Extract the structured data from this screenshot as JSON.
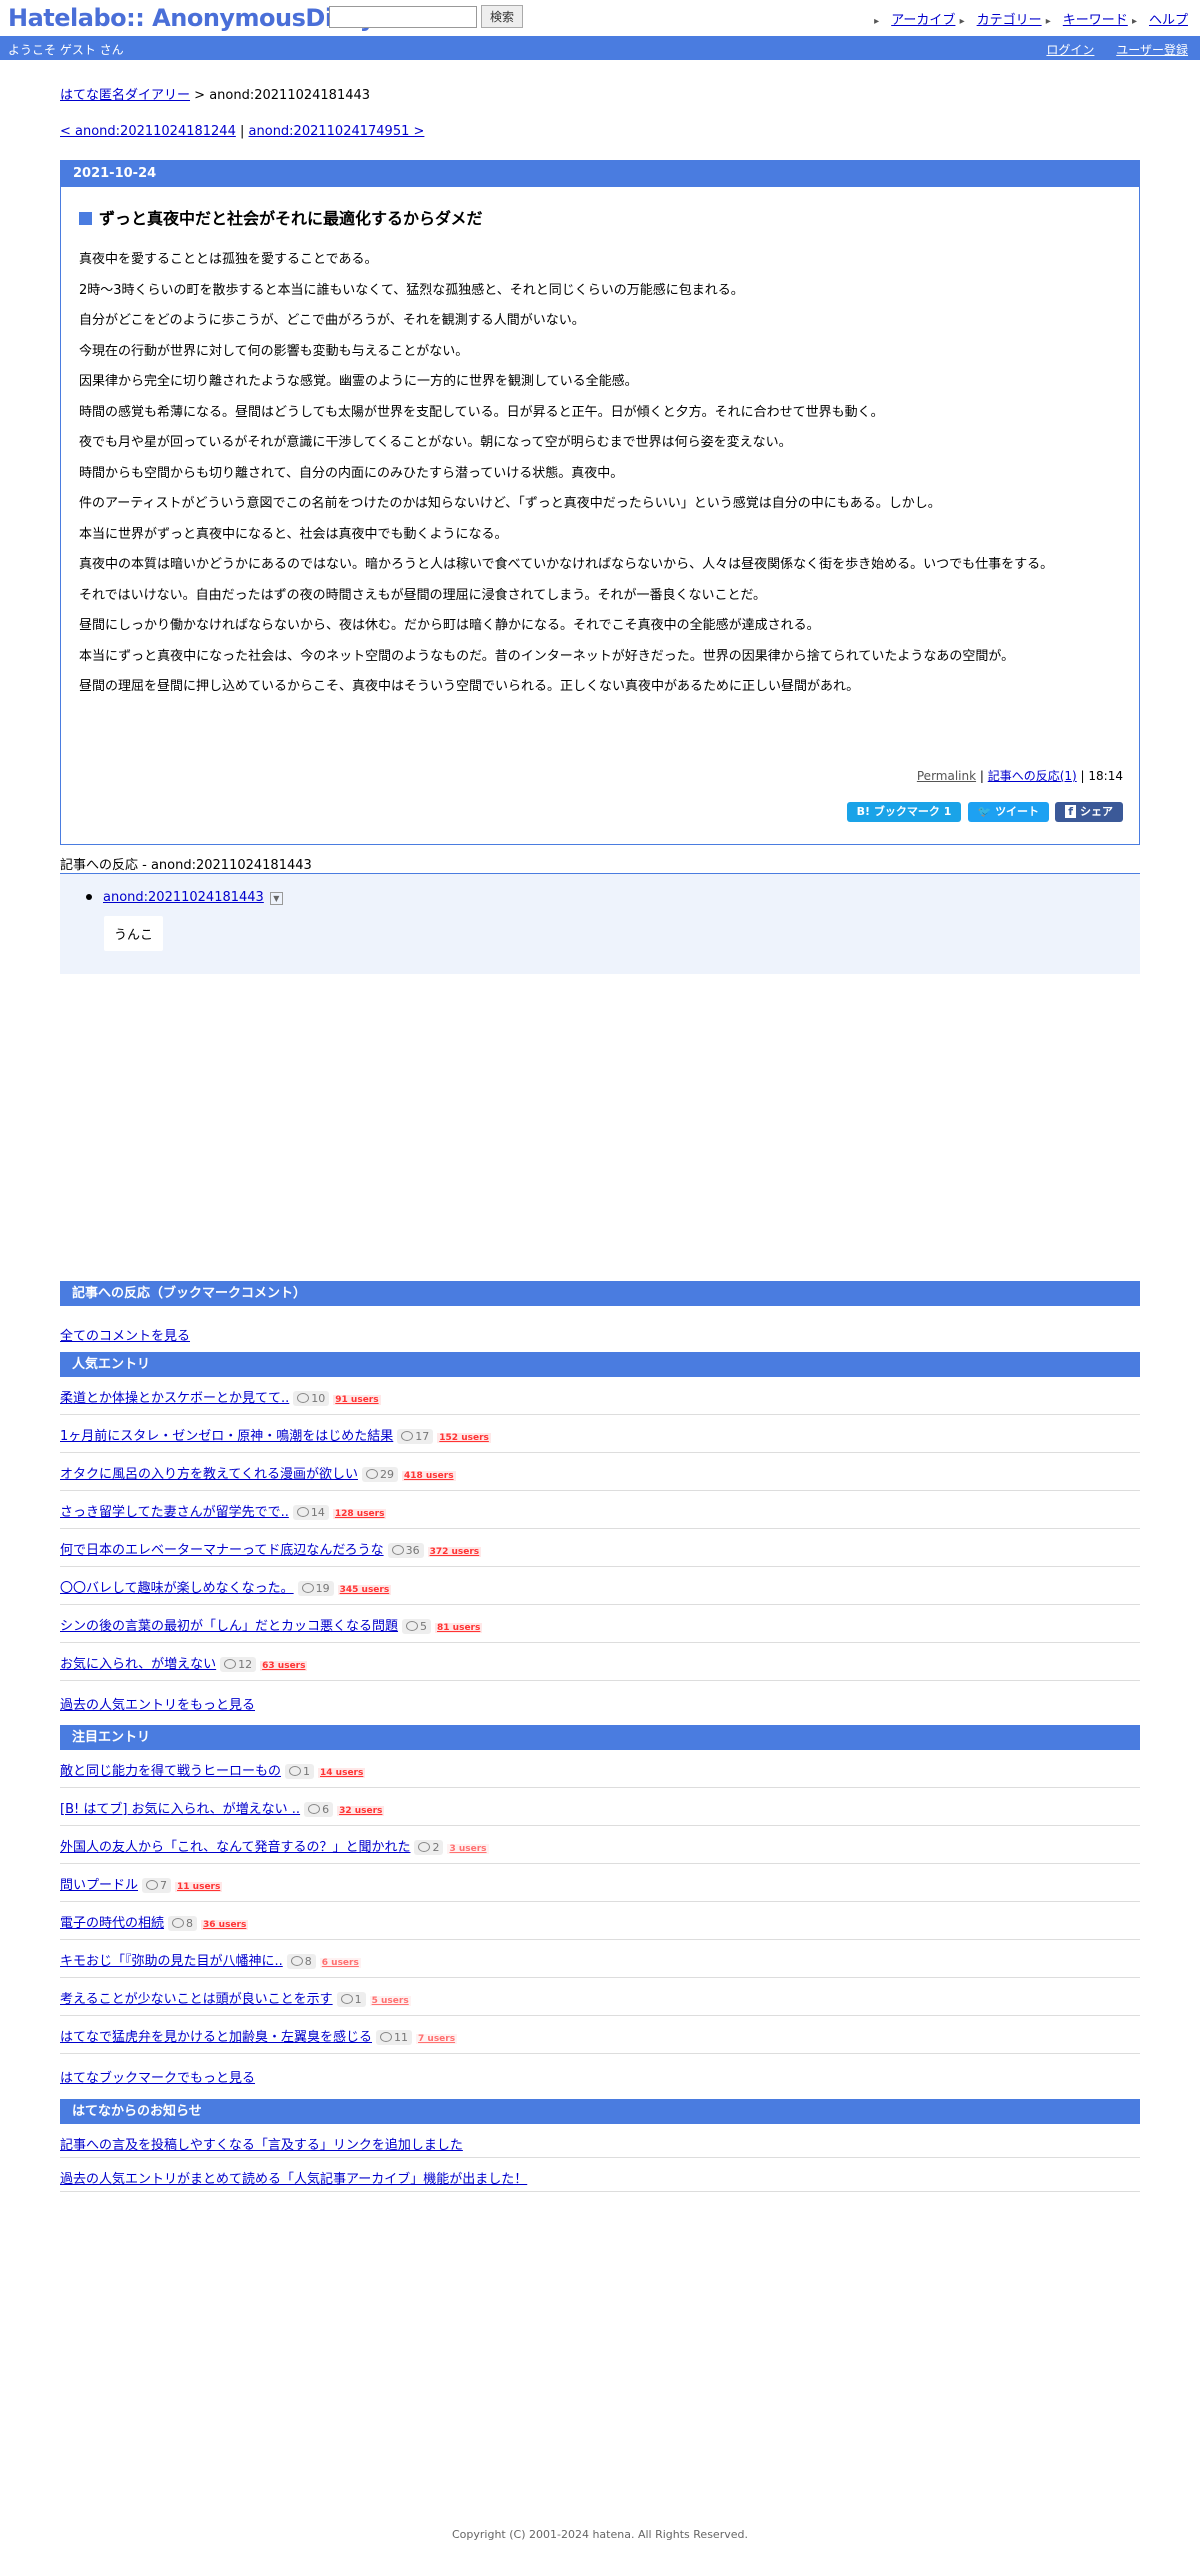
{
  "header": {
    "logo": "Hatelabo:: AnonymousDiary",
    "search_placeholder": "",
    "search_button": "検索",
    "nav": [
      "アーカイブ",
      "カテゴリー",
      "キーワード",
      "ヘルプ"
    ]
  },
  "bluebar": {
    "welcome": "ようこそ ゲスト さん",
    "login": "ログイン",
    "register": "ユーザー登録"
  },
  "breadcrumb": {
    "home": "はてな匿名ダイアリー",
    "sep": ">",
    "current": "anond:20211024181443"
  },
  "pager": {
    "prev": "< anond:20211024181244",
    "sep": "|",
    "next": "anond:20211024174951 >"
  },
  "entry": {
    "date": "2021-10-24",
    "title": "ずっと真夜中だと社会がそれに最適化するからダメだ",
    "paragraphs": [
      "真夜中を愛することとは孤独を愛することである。",
      "2時〜3時くらいの町を散歩すると本当に誰もいなくて、猛烈な孤独感と、それと同じくらいの万能感に包まれる。",
      "自分がどこをどのように歩こうが、どこで曲がろうが、それを観測する人間がいない。",
      "今現在の行動が世界に対して何の影響も変動も与えることがない。",
      "因果律から完全に切り離されたような感覚。幽霊のように一方的に世界を観測している全能感。",
      "時間の感覚も希薄になる。昼間はどうしても太陽が世界を支配している。日が昇ると正午。日が傾くと夕方。それに合わせて世界も動く。",
      "夜でも月や星が回っているがそれが意識に干渉してくることがない。朝になって空が明らむまで世界は何ら姿を変えない。",
      "時間からも空間からも切り離されて、自分の内面にのみひたすら潜っていける状態。真夜中。",
      "件のアーティストがどういう意図でこの名前をつけたのかは知らないけど、「ずっと真夜中だったらいい」という感覚は自分の中にもある。しかし。",
      "本当に世界がずっと真夜中になると、社会は真夜中でも動くようになる。",
      "真夜中の本質は暗いかどうかにあるのではない。暗かろうと人は稼いで食べていかなければならないから、人々は昼夜関係なく街を歩き始める。いつでも仕事をする。",
      "それではいけない。自由だったはずの夜の時間さえもが昼間の理屈に浸食されてしまう。それが一番良くないことだ。",
      "昼間にしっかり働かなければならないから、夜は休む。だから町は暗く静かになる。それでこそ真夜中の全能感が達成される。",
      "本当にずっと真夜中になった社会は、今のネット空間のようなものだ。昔のインターネットが好きだった。世界の因果律から捨てられていたようなあの空間が。",
      "昼間の理屈を昼間に押し込めているからこそ、真夜中はそういう空間でいられる。正しくない真夜中があるために正しい昼間があれ。"
    ],
    "permalink": "Permalink",
    "reactions": "記事への反応(1)",
    "time": "18:14",
    "bookmark": "B! ブックマーク 1",
    "tweet": "ツイート",
    "share": "シェア"
  },
  "responses": {
    "title": "記事への反応 - anond:20211024181443",
    "link": "anond:20211024181443",
    "comment": "うんこ"
  },
  "bm_comment": {
    "head": "記事への反応（ブックマークコメント）",
    "all": "全てのコメントを見る"
  },
  "popular": {
    "head": "人気エントリ",
    "items": [
      {
        "title": "柔道とか体操とかスケボーとか見てて..",
        "comments": "10",
        "users": "91 users"
      },
      {
        "title": "1ヶ月前にスタレ・ゼンゼロ・原神・鳴潮をはじめた結果",
        "comments": "17",
        "users": "152 users"
      },
      {
        "title": "オタクに風呂の入り方を教えてくれる漫画が欲しい",
        "comments": "29",
        "users": "418 users"
      },
      {
        "title": "さっき留学してた妻さんが留学先でで..",
        "comments": "14",
        "users": "128 users"
      },
      {
        "title": "何で日本のエレベーターマナーってド底辺なんだろうな",
        "comments": "36",
        "users": "372 users"
      },
      {
        "title": "〇〇バレして趣味が楽しめなくなった。",
        "comments": "19",
        "users": "345 users"
      },
      {
        "title": "シンの後の言葉の最初が「しん」だとカッコ悪くなる問題",
        "comments": "5",
        "users": "81 users"
      },
      {
        "title": "お気に入られ、が増えない",
        "comments": "12",
        "users": "63 users"
      }
    ],
    "more": "過去の人気エントリをもっと見る"
  },
  "attention": {
    "head": "注目エントリ",
    "items": [
      {
        "title": "敵と同じ能力を得て戦うヒーローもの",
        "comments": "1",
        "users": "14 users"
      },
      {
        "title": "[B! はてブ] お気に入られ、が増えない ..",
        "comments": "6",
        "users": "32 users"
      },
      {
        "title": "外国人の友人から「これ、なんて発音するの？」と聞かれた",
        "comments": "2",
        "users": "3 users"
      },
      {
        "title": "問いプードル",
        "comments": "7",
        "users": "11 users"
      },
      {
        "title": "電子の時代の相続",
        "comments": "8",
        "users": "36 users"
      },
      {
        "title": "キモおじ「『弥助の見た目が八幡神に..",
        "comments": "8",
        "users": "6 users"
      },
      {
        "title": "考えることが少ないことは頭が良いことを示す",
        "comments": "1",
        "users": "5 users"
      },
      {
        "title": "はてなで猛虎弁を見かけると加齢臭・左翼臭を感じる",
        "comments": "11",
        "users": "7 users"
      }
    ],
    "more": "はてなブックマークでもっと見る"
  },
  "news": {
    "head": "はてなからのお知らせ",
    "items": [
      "記事への言及を投稿しやすくなる「言及する」リンクを追加しました",
      "過去の人気エントリがまとめて読める「人気記事アーカイブ」機能が出ました！"
    ]
  },
  "footer": "Copyright (C) 2001-2024 hatena. All Rights Reserved."
}
